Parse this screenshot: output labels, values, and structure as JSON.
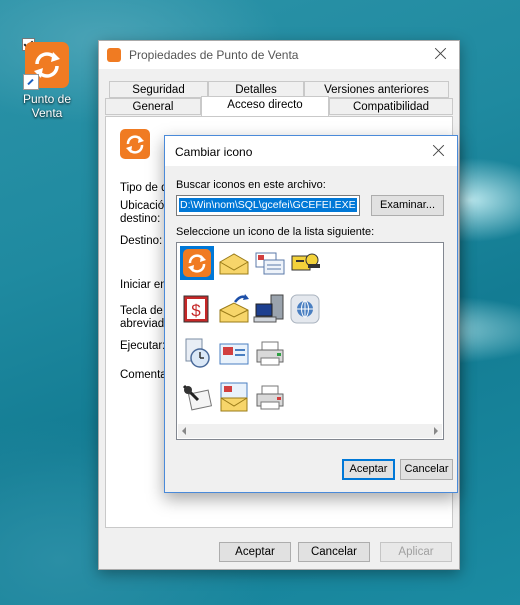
{
  "desktop": {
    "shortcut_label_line1": "Punto de",
    "shortcut_label_line2": "Venta",
    "icon": "sync-arrows-icon",
    "checkbox_checked": true
  },
  "properties_window": {
    "title": "Propiedades de Punto de Venta",
    "tabs_row1": [
      "Seguridad",
      "Detalles",
      "Versiones anteriores"
    ],
    "tabs_row2": [
      "General",
      "Acceso directo",
      "Compatibilidad"
    ],
    "active_tab": "Acceso directo",
    "fields": {
      "tipo": "Tipo de d",
      "ubicacion_1": "Ubicación",
      "ubicacion_2": "destino:",
      "destino": "Destino:",
      "iniciar": "Iniciar en:",
      "tecla_1": "Tecla de m",
      "tecla_2": "abreviado",
      "ejecutar": "Ejecutar:",
      "comentario": "Comentari"
    },
    "buttons": {
      "ok": "Aceptar",
      "cancel": "Cancelar",
      "apply": "Aplicar"
    }
  },
  "change_icon_dialog": {
    "title": "Cambiar icono",
    "search_label": "Buscar iconos en este archivo:",
    "path_value": "D:\\Win\\nom\\SQL\\gcefei\\GCEFEI.EXE",
    "browse_label": "Examinar...",
    "list_label": "Seleccione un icono de la lista siguiente:",
    "icons": [
      "sync-arrows-icon",
      "envelope-icon",
      "mail-letters-icon",
      "key-lock-icon",
      "calculator-dollar-icon",
      "mail-send-icon",
      "computer-server-icon",
      "network-globe-icon",
      "clock-document-icon",
      "email-card-icon",
      "printer-green-icon",
      "writing-hand-icon",
      "email-envelope-icon",
      "printer-red-icon"
    ],
    "buttons": {
      "ok": "Aceptar",
      "cancel": "Cancelar"
    },
    "accent": "#0078d7"
  }
}
